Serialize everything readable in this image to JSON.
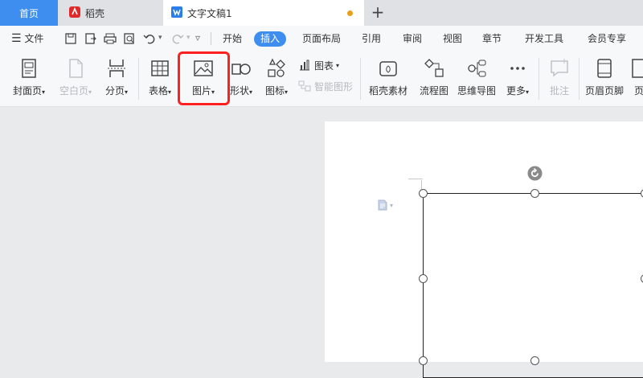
{
  "tabs": {
    "home": "首页",
    "daoke": "稻壳",
    "doc": "文字文稿1",
    "new_tab": "+"
  },
  "menu": {
    "file": "文件",
    "items": [
      "开始",
      "插入",
      "页面布局",
      "引用",
      "审阅",
      "视图",
      "章节",
      "开发工具",
      "会员专享"
    ]
  },
  "ribbon": {
    "cover": "封面页",
    "blank": "空白页",
    "page_break": "分页",
    "table": "表格",
    "picture": "图片",
    "shape": "形状",
    "icon": "图标",
    "chart": "图表",
    "smart_art": "智能图形",
    "daoke_material": "稻壳素材",
    "flowchart": "流程图",
    "mindmap": "思维导图",
    "more": "更多",
    "comment": "批注",
    "header_footer": "页眉页脚",
    "page_num": "页"
  },
  "colors": {
    "accent": "#3d8eef",
    "highlight": "#ff2020",
    "unsaved_dot": "#e8a019"
  }
}
